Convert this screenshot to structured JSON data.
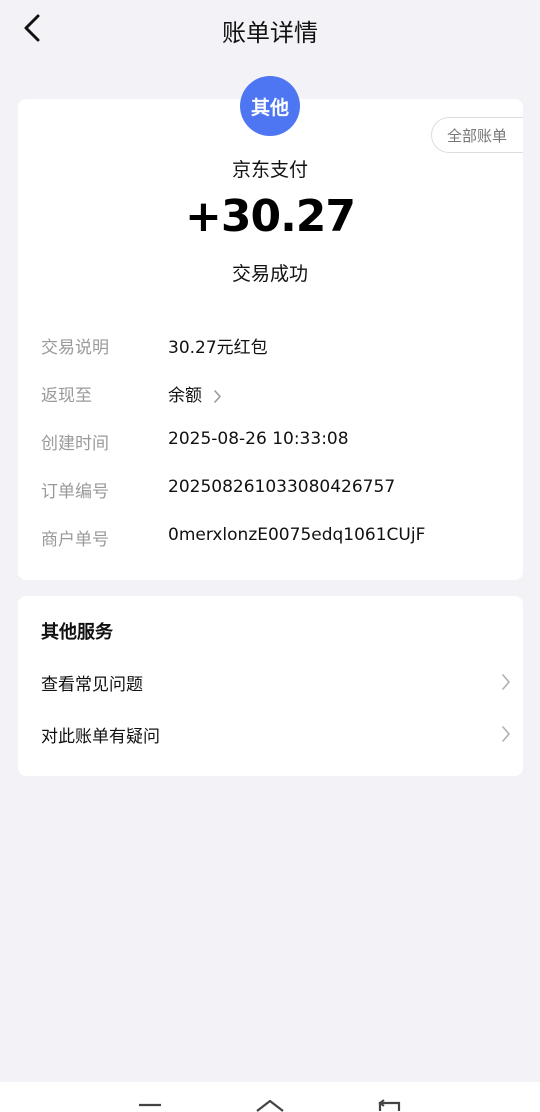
{
  "header": {
    "title": "账单详情",
    "back_icon": "back-arrow-icon"
  },
  "summary": {
    "badge": "其他",
    "badge_color": "#4f76f2",
    "all_bills_label": "全部账单",
    "merchant": "京东支付",
    "amount": "+30.27",
    "status": "交易成功"
  },
  "details": [
    {
      "label": "交易说明",
      "value": "30.27元红包"
    },
    {
      "label": "返现至",
      "value": "余额",
      "has_chevron": true
    },
    {
      "label": "创建时间",
      "value": "2025-08-26 10:33:08"
    },
    {
      "label": "订单编号",
      "value": "20250826103308042 6757"
    },
    {
      "label": "商户单号",
      "value": "0merxlonzE0075edq1061CUjF"
    }
  ],
  "services": {
    "title": "其他服务",
    "items": [
      {
        "label": "查看常见问题"
      },
      {
        "label": "对此账单有疑问"
      }
    ]
  },
  "nav": {
    "icons": [
      "menu-icon",
      "home-icon",
      "return-icon"
    ]
  }
}
